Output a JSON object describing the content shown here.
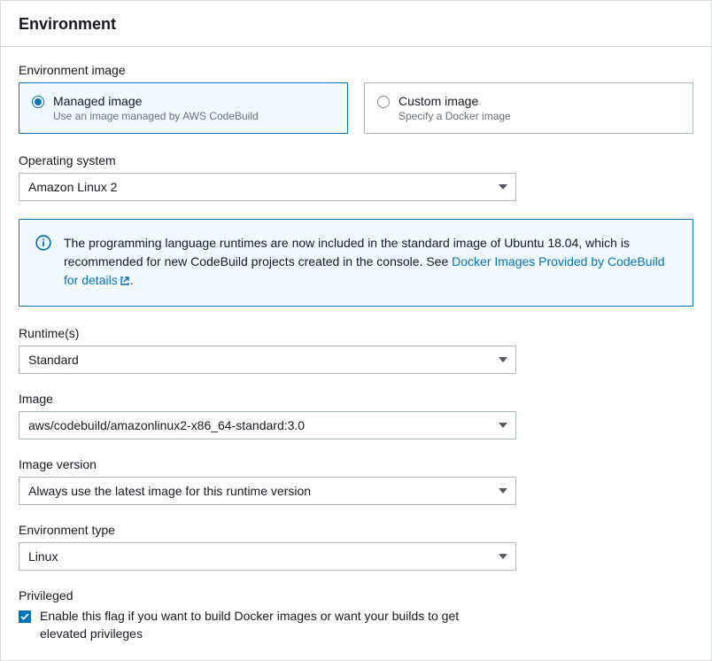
{
  "panelTitle": "Environment",
  "envImage": {
    "label": "Environment image",
    "managed": {
      "title": "Managed image",
      "desc": "Use an image managed by AWS CodeBuild"
    },
    "custom": {
      "title": "Custom image",
      "desc": "Specify a Docker image"
    }
  },
  "os": {
    "label": "Operating system",
    "value": "Amazon Linux 2"
  },
  "infoAlert": {
    "text1": "The programming language runtimes are now included in the standard image of Ubuntu 18.04, which is recommended for new CodeBuild projects created in the console. See ",
    "linkText": "Docker Images Provided by CodeBuild for details",
    "text2": "."
  },
  "runtime": {
    "label": "Runtime(s)",
    "value": "Standard"
  },
  "image": {
    "label": "Image",
    "value": "aws/codebuild/amazonlinux2-x86_64-standard:3.0"
  },
  "imageVer": {
    "label": "Image version",
    "value": "Always use the latest image for this runtime version"
  },
  "envType": {
    "label": "Environment type",
    "value": "Linux"
  },
  "privileged": {
    "label": "Privileged",
    "desc": "Enable this flag if you want to build Docker images or want your builds to get elevated privileges"
  }
}
